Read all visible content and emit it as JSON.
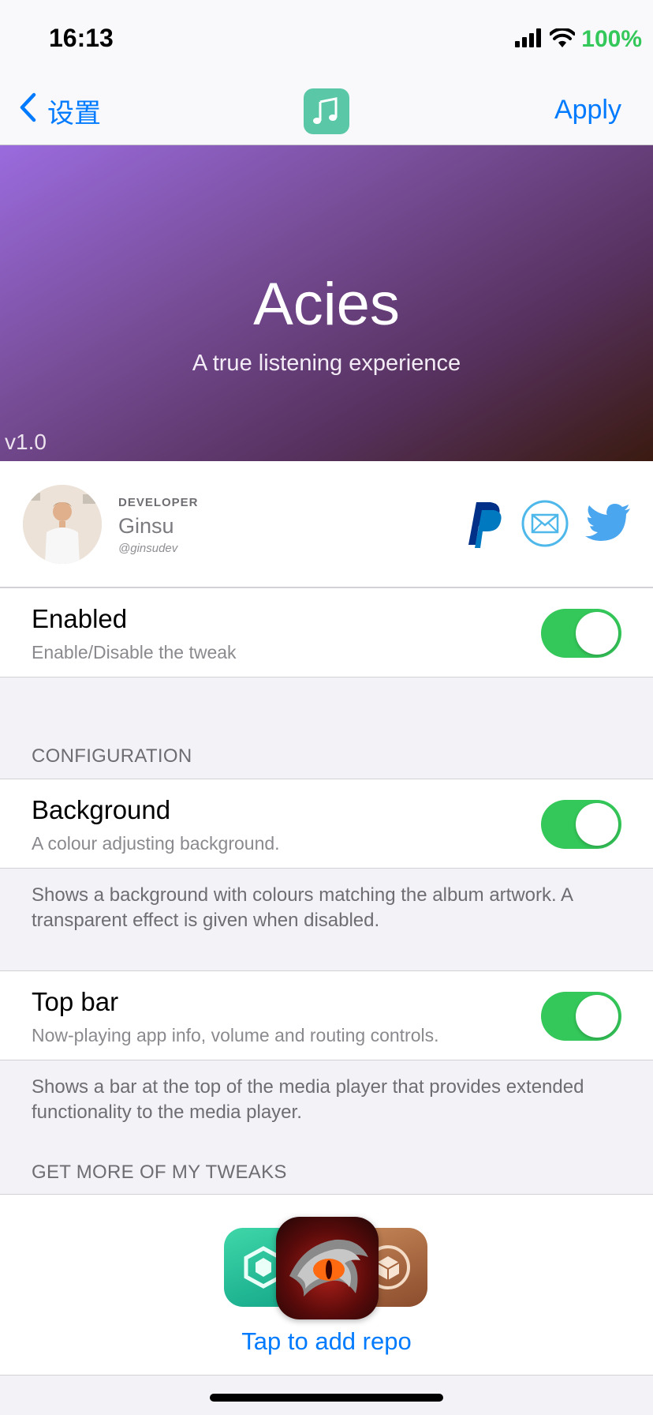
{
  "status_bar": {
    "time": "16:13",
    "battery": "100%",
    "battery_color": "#34c759"
  },
  "nav": {
    "back_label": "设置",
    "apply_label": "Apply",
    "app_icon": "music-notes-icon",
    "accent": "#007aff"
  },
  "banner": {
    "title": "Acies",
    "subtitle": "A true listening experience",
    "version": "v1.0"
  },
  "developer": {
    "label": "DEVELOPER",
    "name": "Ginsu",
    "handle": "@ginsudev",
    "links": [
      "paypal-icon",
      "mail-icon",
      "twitter-icon"
    ]
  },
  "settings": {
    "enabled": {
      "title": "Enabled",
      "subtitle": "Enable/Disable the tweak",
      "on": true
    },
    "config_header": "CONFIGURATION",
    "background": {
      "title": "Background",
      "subtitle": "A colour adjusting background.",
      "on": true,
      "footer": "Shows a background with colours matching the album artwork. A transparent effect is given when disabled."
    },
    "topbar": {
      "title": "Top bar",
      "subtitle": "Now-playing app info, volume and routing controls.",
      "on": true,
      "footer": "Shows a bar at the top of the media player that provides extended functionality to the media player."
    },
    "more_header": "GET MORE OF MY TWEAKS"
  },
  "repo": {
    "action_label": "Tap to add repo",
    "icons": [
      "sileo-icon",
      "dragon-eye-icon",
      "cydia-icon"
    ]
  },
  "toggle_color": "#34c759"
}
